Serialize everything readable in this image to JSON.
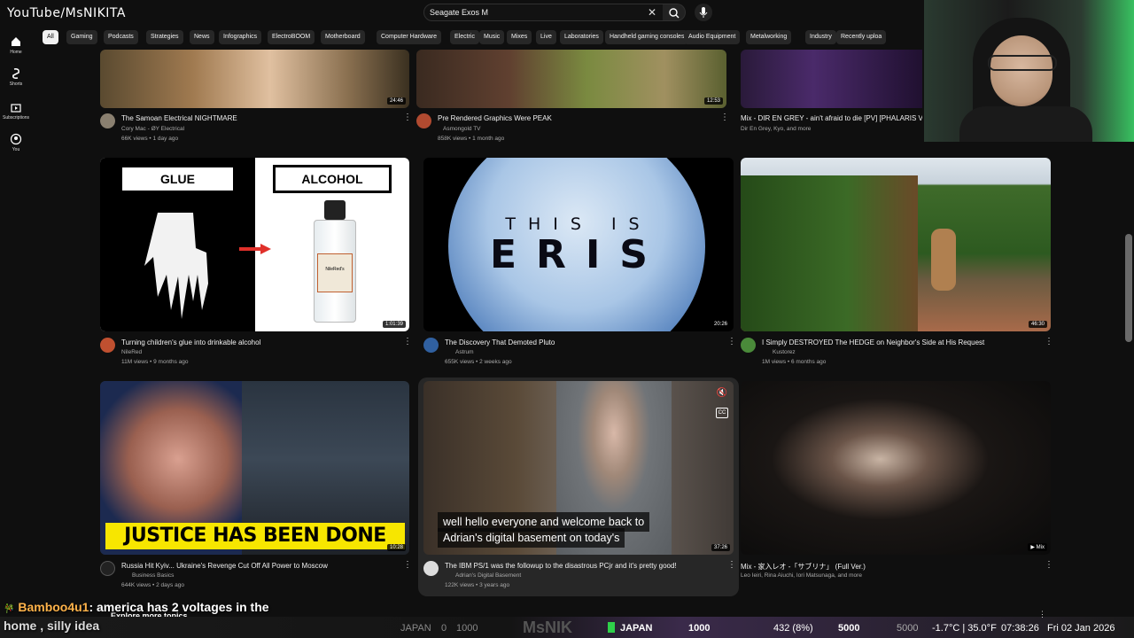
{
  "app": {
    "brand": "YouTube/MsNIKITA"
  },
  "search": {
    "value": "Seagate Exos M",
    "placeholder": "Search"
  },
  "chips": [
    "All",
    "Gaming",
    "Podcasts",
    "Strategies",
    "News",
    "Infographics",
    "ElectroBOOM",
    "Motherboard",
    "Computer Hardware",
    "Electric",
    "Music",
    "Mixes",
    "Live",
    "Laboratories",
    "Handheld gaming consoles",
    "Audio Equipment",
    "Metalworking",
    "Industry",
    "Recently uploa"
  ],
  "sidebar": [
    {
      "label": "Home",
      "icon": "home-icon"
    },
    {
      "label": "Shorts",
      "icon": "shorts-icon"
    },
    {
      "label": "Subscriptions",
      "icon": "subscriptions-icon"
    },
    {
      "label": "You",
      "icon": "you-icon"
    }
  ],
  "videos": [
    {
      "title": "The Samoan Electrical NIGHTMARE",
      "channel": "Cory Mac - ØY Electrical",
      "meta": "66K views • 1 day ago",
      "duration": "24:46"
    },
    {
      "title": "Pre Rendered Graphics Were PEAK",
      "channel": "Asmongold TV",
      "meta": "858K views • 1 month ago",
      "duration": "12:53"
    },
    {
      "title": "Mix - DIR EN GREY - ain't afraid to die [PV] [PHALARIS Ver",
      "channel": "Dir En Grey, Kyo, and more",
      "meta": "",
      "duration": ""
    },
    {
      "title": "Turning children's glue into drinkable alcohol",
      "channel": "NileRed",
      "meta": "11M views • 9 months ago",
      "duration": "1:01:39",
      "thumb_left": "GLUE",
      "thumb_right": "ALCOHOL",
      "bottle_label": "NileRed's"
    },
    {
      "title": "The Discovery That Demoted Pluto",
      "channel": "Astrum",
      "meta": "655K views • 2 weeks ago",
      "duration": "20:26",
      "thumb_line1": "THIS IS",
      "thumb_line2": "ERIS"
    },
    {
      "title": "I Simply DESTROYED The HEDGE on Neighbor's Side at His Request",
      "channel": "Kustorez",
      "meta": "1M views • 6 months ago",
      "duration": "46:30"
    },
    {
      "title": "Russia Hit Kyiv... Ukraine's Revenge Cut Off All Power to Moscow",
      "channel": "Business Basics",
      "meta": "644K views • 2 days ago",
      "duration": "10:28",
      "thumb_banner": "JUSTICE HAS BEEN DONE"
    },
    {
      "title": "The IBM PS/1 was the followup to the disastrous PCjr and it's pretty good!",
      "channel": "Adrian's Digital Basement",
      "meta": "122K views • 3 years ago",
      "duration": "37:26",
      "caption_line1": "well hello everyone and welcome back to",
      "caption_line2": "Adrian's digital basement on today's"
    },
    {
      "title": "Mix - 家入レオ -「サブリナ」 (Full Ver.)",
      "channel": "Leo Ieiri, Rina Aiuchi, Iori Matsunaga, and more",
      "meta": "",
      "duration": "Mix"
    }
  ],
  "explore": "Explore more topics",
  "chat": {
    "user": "Bamboo4u1",
    "message": ": america has 2 voltages in the",
    "message2": "home , silly idea"
  },
  "status": {
    "japan1": "JAPAN",
    "zero": "0",
    "thousand1": "1000",
    "stream_name": "MsNIK",
    "japan2": "JAPAN",
    "thousand2": "1000",
    "counter": "432 (8%)",
    "five_k": "5000",
    "five_k2": "5000",
    "temp": "-1.7°C | 35.0°F",
    "time": "07:38:26",
    "date": "Fri 02 Jan 2026"
  },
  "colors": {
    "bg": "#0f0f0f",
    "chip": "#272727",
    "chip_active": "#f1f1f1",
    "accent": "#ff0000",
    "banner_yellow": "#f7e600"
  }
}
